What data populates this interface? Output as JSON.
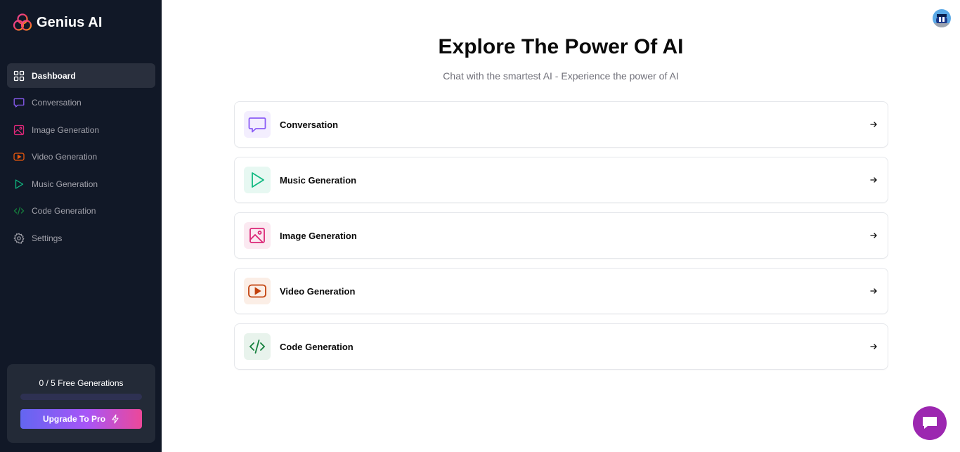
{
  "brand": {
    "title": "Genius AI"
  },
  "sidebar": {
    "items": [
      {
        "label": "Dashboard",
        "icon": "dashboard-icon",
        "color": "#ffffff",
        "active": true
      },
      {
        "label": "Conversation",
        "icon": "message-square-icon",
        "color": "#8b5cf6"
      },
      {
        "label": "Image Generation",
        "icon": "image-icon",
        "color": "#db2777"
      },
      {
        "label": "Video Generation",
        "icon": "video-icon",
        "color": "#ea580c"
      },
      {
        "label": "Music Generation",
        "icon": "play-icon",
        "color": "#10b981"
      },
      {
        "label": "Code Generation",
        "icon": "code-icon",
        "color": "#15803d"
      },
      {
        "label": "Settings",
        "icon": "settings-icon",
        "color": "#a1a1aa"
      }
    ],
    "free_card": {
      "text": "0 / 5 Free Generations",
      "progress_fraction": 0,
      "upgrade_label": "Upgrade To Pro",
      "upgrade_icon": "zap-icon"
    }
  },
  "main": {
    "title": "Explore The Power Of AI",
    "subtitle": "Chat with the smartest AI - Experience the power of AI",
    "tools": [
      {
        "label": "Conversation",
        "icon": "message-square-icon",
        "color": "#8b5cf6",
        "bg": "#f3eefe"
      },
      {
        "label": "Music Generation",
        "icon": "play-icon",
        "color": "#10b981",
        "bg": "#e7f8f2"
      },
      {
        "label": "Image Generation",
        "icon": "image-icon",
        "color": "#db2777",
        "bg": "#fbe9f1"
      },
      {
        "label": "Video Generation",
        "icon": "video-icon",
        "color": "#c2410c",
        "bg": "#fbeee6"
      },
      {
        "label": "Code Generation",
        "icon": "code-icon",
        "color": "#15803d",
        "bg": "#e8f3ec"
      }
    ]
  },
  "colors": {
    "sidebar_bg": "#111827",
    "chat_fab": "#9c27b0",
    "accent": "#6366f1"
  }
}
